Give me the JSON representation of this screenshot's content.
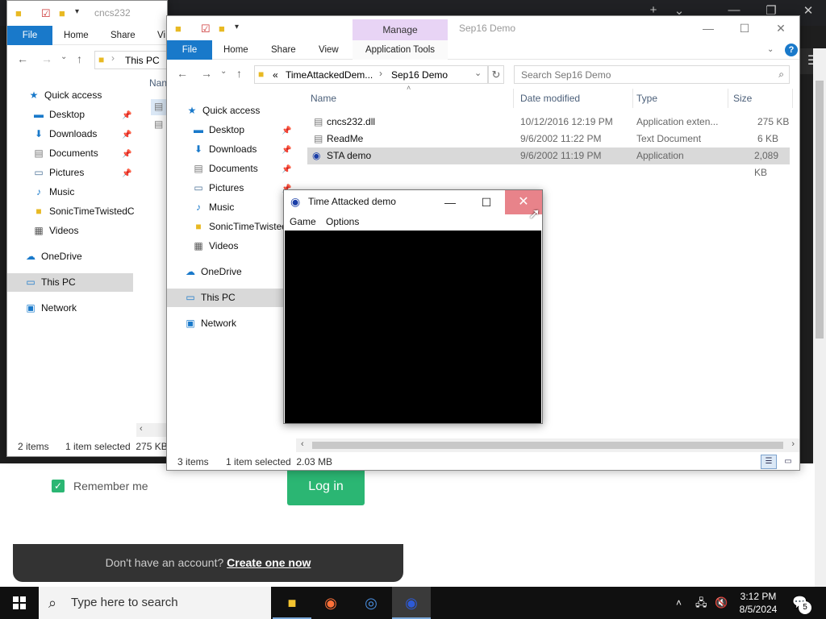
{
  "bg_explorer": {
    "title": "cncs232",
    "ribbon": [
      "File",
      "Home",
      "Share",
      "Vi"
    ],
    "address": "This PC",
    "name_header": "Nan",
    "tree": [
      "Quick access",
      "Desktop",
      "Downloads",
      "Documents",
      "Pictures",
      "Music",
      "SonicTimeTwistedC",
      "Videos",
      "OneDrive",
      "This PC",
      "Network"
    ],
    "status_items": "2 items",
    "status_selected": "1 item selected  275 KB"
  },
  "explorer": {
    "title": "Sep16 Demo",
    "manage_label": "Manage",
    "ribbon": {
      "file": "File",
      "home": "Home",
      "share": "Share",
      "view": "View",
      "app_tools": "Application Tools"
    },
    "breadcrumb": {
      "root": "«",
      "parent": "TimeAttackedDem...",
      "current": "Sep16 Demo"
    },
    "search_placeholder": "Search Sep16 Demo",
    "columns": {
      "name": "Name",
      "date": "Date modified",
      "type": "Type",
      "size": "Size"
    },
    "files": [
      {
        "name": "cncs232.dll",
        "date": "10/12/2016 12:19 PM",
        "type": "Application exten...",
        "size": "275 KB"
      },
      {
        "name": "ReadMe",
        "date": "9/6/2002 11:22 PM",
        "type": "Text Document",
        "size": "6 KB"
      },
      {
        "name": "STA demo",
        "date": "9/6/2002 11:19 PM",
        "type": "Application",
        "size": "2,089 KB"
      }
    ],
    "tree": {
      "quick_access": "Quick access",
      "desktop": "Desktop",
      "downloads": "Downloads",
      "documents": "Documents",
      "pictures": "Pictures",
      "music": "Music",
      "sonic": "SonicTimeTwistedC",
      "videos": "Videos",
      "onedrive": "OneDrive",
      "this_pc": "This PC",
      "network": "Network"
    },
    "status_items": "3 items",
    "status_selected": "1 item selected  2.03 MB"
  },
  "game": {
    "title": "Time Attacked demo",
    "menu": [
      "Game",
      "Options"
    ]
  },
  "web": {
    "remember": "Remember me",
    "login": "Log in",
    "no_account": "Don't have an account?",
    "create": "Create one now"
  },
  "taskbar": {
    "search": "Type here to search",
    "time": "3:12 PM",
    "date": "8/5/2024",
    "notifications": "5"
  },
  "colors": {
    "accent": "#1979ca",
    "green": "#2bb673",
    "close_hover": "#e8838a",
    "manage": "#e8d4f5"
  }
}
